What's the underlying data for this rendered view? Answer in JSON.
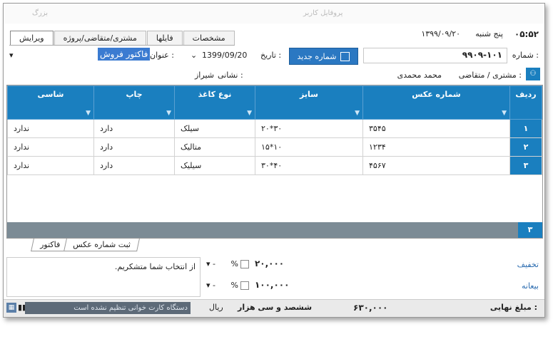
{
  "header": {
    "time": "۰۵:۵۲",
    "day": "پنج شنبه",
    "date": "۱۳۹۹/۰۹/۲۰"
  },
  "ghost": {
    "left": "بزرگ",
    "right": "پروفایل کاربر"
  },
  "tabs": [
    "ویرایش",
    "مشتری/متقاضی/پروژه",
    "فایلها",
    "مشخصات"
  ],
  "form": {
    "number_label": "شماره :",
    "number_value": "۹۹۰۹-۱۰۱",
    "new_number": "شماره جدید",
    "date_label": "تاریخ :",
    "date_value": "1399/09/20",
    "title_label": "عنوان :",
    "title_value": "فاکتور فروش",
    "customer_label": "مشتری / متقاضی :",
    "customer_value": "محمد محمدی",
    "address_label": "نشانی :",
    "address_value": "شیراز"
  },
  "grid": {
    "columns": [
      "ردیف",
      "شماره عکس",
      "سایز",
      "نوع کاغذ",
      "چاپ",
      "شاسی"
    ],
    "rows": [
      [
        "۱",
        "۳۵۴۵",
        "۳۰*۲۰",
        "سیلک",
        "دارد",
        "ندارد"
      ],
      [
        "۲",
        "۱۲۳۴",
        "۱۰*۱۵",
        "متالیک",
        "دارد",
        "ندارد"
      ],
      [
        "۳",
        "۴۵۶۷",
        "۴۰*۳۰",
        "سیلیک",
        "دارد",
        "ندارد"
      ]
    ],
    "count": "۳"
  },
  "bottom_tabs": [
    "فاکتور",
    "ثبت شماره عکس"
  ],
  "discount": {
    "label": "تخفیف",
    "amount": "۲۰,۰۰۰",
    "percent": "%"
  },
  "prepay": {
    "label": "بیعانه",
    "amount": "۱۰۰,۰۰۰",
    "percent": "%"
  },
  "message": "از انتخاب شما متشکریم.",
  "status": {
    "card": "دستگاه کارت خوانی تنظیم نشده است",
    "final_label": "مبلغ نهایی :",
    "final_value": "۶۳۰,۰۰۰",
    "words": "ششصد و سی هزار",
    "currency": "ریال"
  }
}
